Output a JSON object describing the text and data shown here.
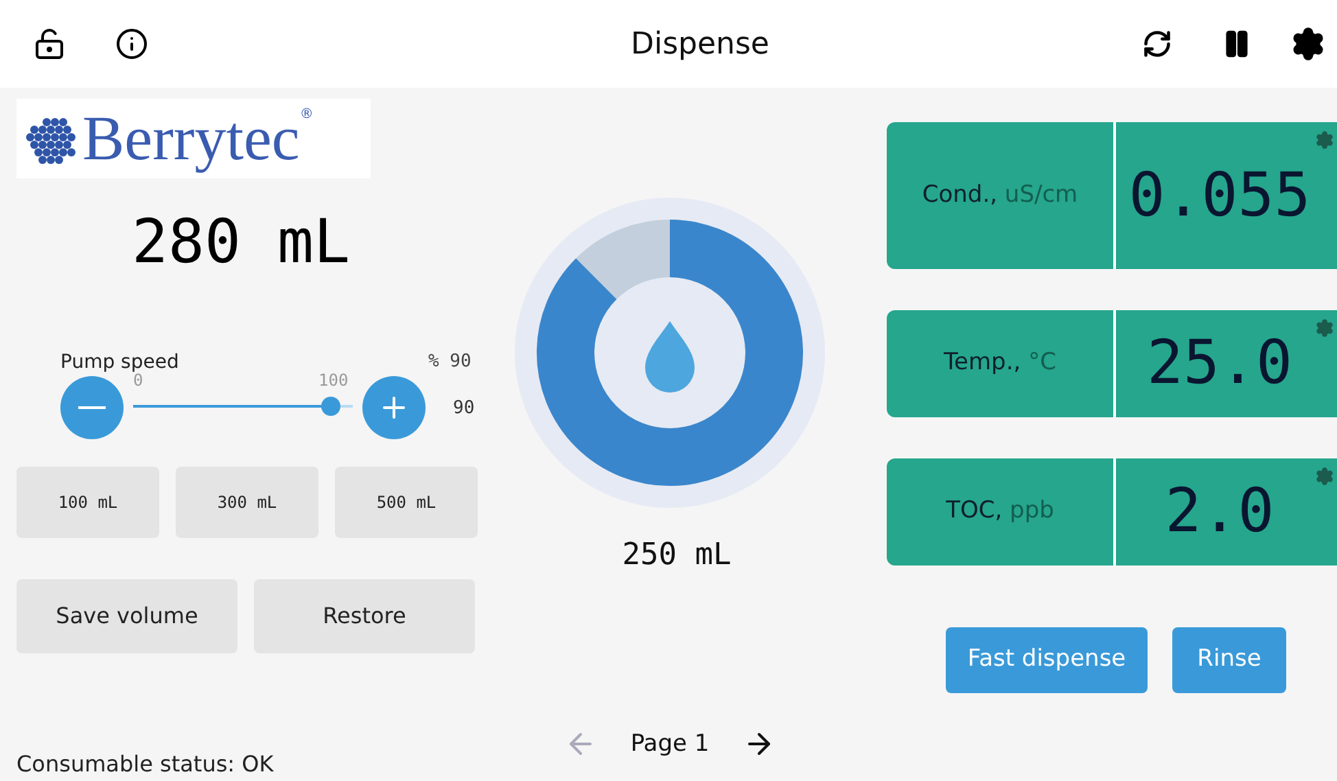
{
  "header": {
    "title": "Dispense"
  },
  "logo": {
    "name": "Berrytec",
    "mark": "®"
  },
  "volume": "280 mL",
  "pump_speed": {
    "label": "Pump speed",
    "unit": "% 90",
    "min": "0",
    "max": "100",
    "value": "90",
    "level": 0.9
  },
  "presets": [
    "100 mL",
    "300 mL",
    "500 mL"
  ],
  "actions": [
    "Save volume",
    "Restore"
  ],
  "status": "Consumable status: OK",
  "dispense_gauge": {
    "reading": "250 mL"
  },
  "pager": {
    "label": "Page 1",
    "prev_disabled": true,
    "next_disabled": false
  },
  "readings": [
    {
      "name": "Cond.,",
      "unit": "uS/cm",
      "value": "0.055"
    },
    {
      "name": "Temp.,",
      "unit": "°C",
      "value": "25.0"
    },
    {
      "name": "TOC,",
      "unit": "ppb",
      "value": "2.0"
    }
  ],
  "buttons": [
    "Fast dispense",
    "Rinse"
  ]
}
